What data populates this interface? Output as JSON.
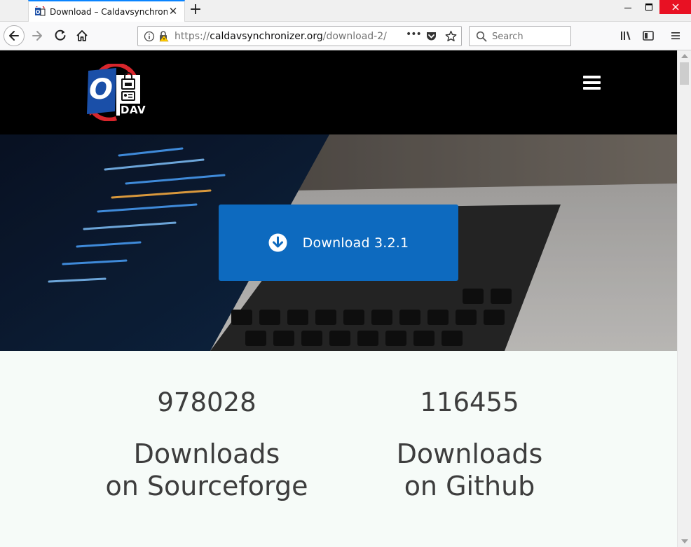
{
  "browser": {
    "tab_title": "Download – Caldavsynchronizer",
    "new_tab": "+",
    "url_domain": "caldavsynchronizer.org",
    "url_prefix": "https://",
    "url_path": "/download-2/",
    "search_placeholder": "Search",
    "page_actions": "•••"
  },
  "header": {
    "logo_text": "DAV",
    "logo_letter": "O"
  },
  "hero": {
    "download_label": "Download 3.2.1"
  },
  "stats": [
    {
      "count": "978028",
      "label_line1": "Downloads",
      "label_line2": "on Sourceforge"
    },
    {
      "count": "116455",
      "label_line1": "Downloads",
      "label_line2": "on Github"
    }
  ],
  "colors": {
    "header_bg": "#000000",
    "download_button": "#0d6abf",
    "stats_bg": "#f6fbf8",
    "text_dark": "#3d3d3d",
    "logo_blue": "#1a4fa8",
    "logo_red": "#d8262c"
  }
}
